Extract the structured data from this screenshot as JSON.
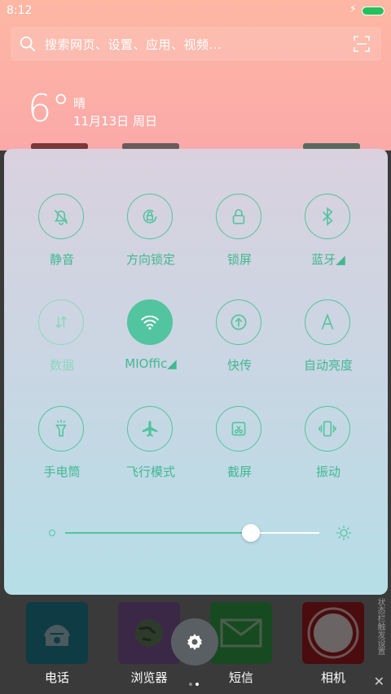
{
  "status_bar": {
    "time": "8:12",
    "bolt": "⚡"
  },
  "search": {
    "placeholder": "搜索网页、设置、应用、视频..."
  },
  "weather": {
    "temperature": "6°",
    "condition": "晴",
    "date": "11月13日 周日"
  },
  "toggles": [
    {
      "label": "静音",
      "icon": "bell-muted-icon",
      "state": "off"
    },
    {
      "label": "方向锁定",
      "icon": "rotation-lock-icon",
      "state": "off"
    },
    {
      "label": "锁屏",
      "icon": "lock-icon",
      "state": "off"
    },
    {
      "label": "蓝牙◢",
      "icon": "bluetooth-icon",
      "state": "off"
    },
    {
      "label": "数据",
      "icon": "mobile-data-icon",
      "state": "disabled"
    },
    {
      "label": "MIOffic◢",
      "icon": "wifi-icon",
      "state": "on"
    },
    {
      "label": "快传",
      "icon": "quick-transfer-icon",
      "state": "off"
    },
    {
      "label": "自动亮度",
      "icon": "auto-brightness-icon",
      "state": "off"
    },
    {
      "label": "手电筒",
      "icon": "flashlight-icon",
      "state": "off"
    },
    {
      "label": "飞行模式",
      "icon": "airplane-icon",
      "state": "off"
    },
    {
      "label": "截屏",
      "icon": "screenshot-icon",
      "state": "off"
    },
    {
      "label": "振动",
      "icon": "vibrate-icon",
      "state": "off"
    }
  ],
  "brightness": {
    "level": 0.73
  },
  "dock": {
    "apps": [
      {
        "label": "电话",
        "icon": "phone-icon",
        "color": "#0e3b44"
      },
      {
        "label": "浏览器",
        "icon": "browser-icon",
        "color": "#3b2846"
      },
      {
        "label": "短信",
        "icon": "message-icon",
        "color": "#174a21"
      },
      {
        "label": "相机",
        "icon": "camera-icon",
        "color": "#4a0c0e"
      }
    ],
    "side_note": "状态栏触发设置"
  },
  "colors": {
    "accent": "#52c4a0",
    "label": "#41b893",
    "top_bg": "#fba9a9"
  }
}
